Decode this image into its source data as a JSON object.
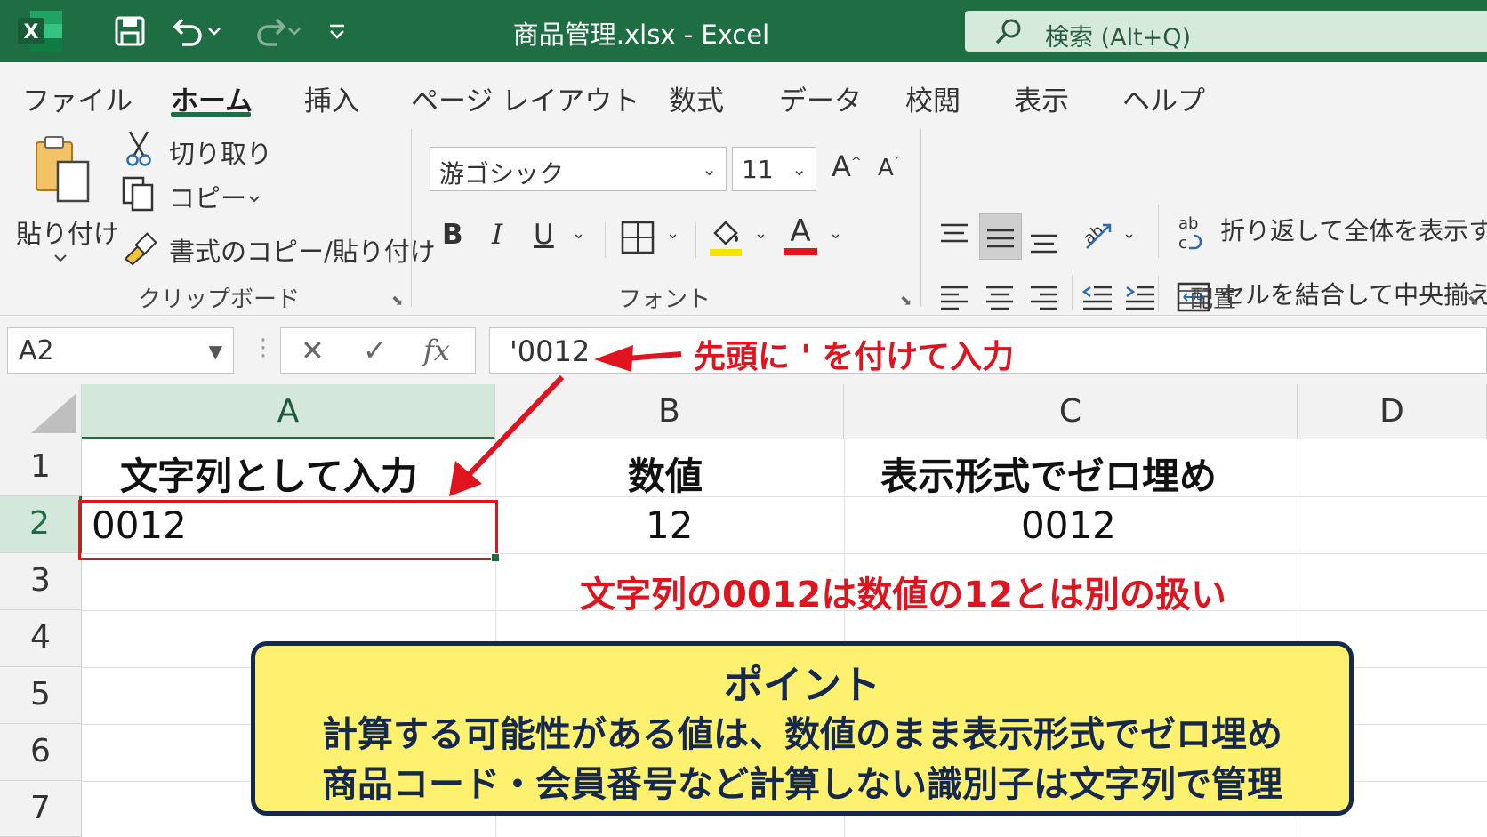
{
  "window": {
    "title": "商品管理.xlsx  -  Excel",
    "search_placeholder": "検索 (Alt+Q)",
    "app_badge": "X"
  },
  "ribbon": {
    "tabs": [
      {
        "label": "ファイル"
      },
      {
        "label": "ホーム"
      },
      {
        "label": "挿入"
      },
      {
        "label": "ページ レイアウト"
      },
      {
        "label": "数式"
      },
      {
        "label": "データ"
      },
      {
        "label": "校閲"
      },
      {
        "label": "表示"
      },
      {
        "label": "ヘルプ"
      }
    ],
    "active_tab": "ホーム",
    "clipboard": {
      "paste_label": "貼り付け",
      "cut_label": "切り取り",
      "copy_label": "コピー",
      "format_painter_label": "書式のコピー/貼り付け",
      "group_label": "クリップボード"
    },
    "font": {
      "font_name": "游ゴシック",
      "font_size": "11",
      "bold": "B",
      "italic": "I",
      "underline": "U",
      "font_color_letter": "A",
      "group_label": "フォント",
      "highlight_color": "#f5e400",
      "font_color": "#e0141e"
    },
    "alignment": {
      "wrap_text_label": "折り返して全体を表示する",
      "merge_center_label": "セルを結合して中央揃え",
      "group_label": "配置"
    }
  },
  "formula_bar": {
    "name_box": "A2",
    "fx": "fx",
    "formula": "'0012",
    "annotation": "先頭に ' を付けて入力"
  },
  "sheet": {
    "columns": [
      "A",
      "B",
      "C",
      "D"
    ],
    "rows": [
      "1",
      "2",
      "3",
      "4",
      "5",
      "6",
      "7"
    ],
    "selected_cell": "A2",
    "cells": {
      "A1": "文字列として入力",
      "B1": "数値",
      "C1": "表示形式でゼロ埋め",
      "A2": "0012",
      "B2": "12",
      "C2": "0012"
    },
    "note": "文字列の0012は数値の12とは別の扱い"
  },
  "point_box": {
    "title": "ポイント",
    "line1": "計算する可能性がある値は、数値のまま表示形式でゼロ埋め",
    "line2": "商品コード・会員番号など計算しない識別子は文字列で管理"
  },
  "colors": {
    "excel_green": "#1f6e43",
    "annotation_red": "#e0141e",
    "point_bg": "#fff170",
    "point_border": "#15294f"
  }
}
